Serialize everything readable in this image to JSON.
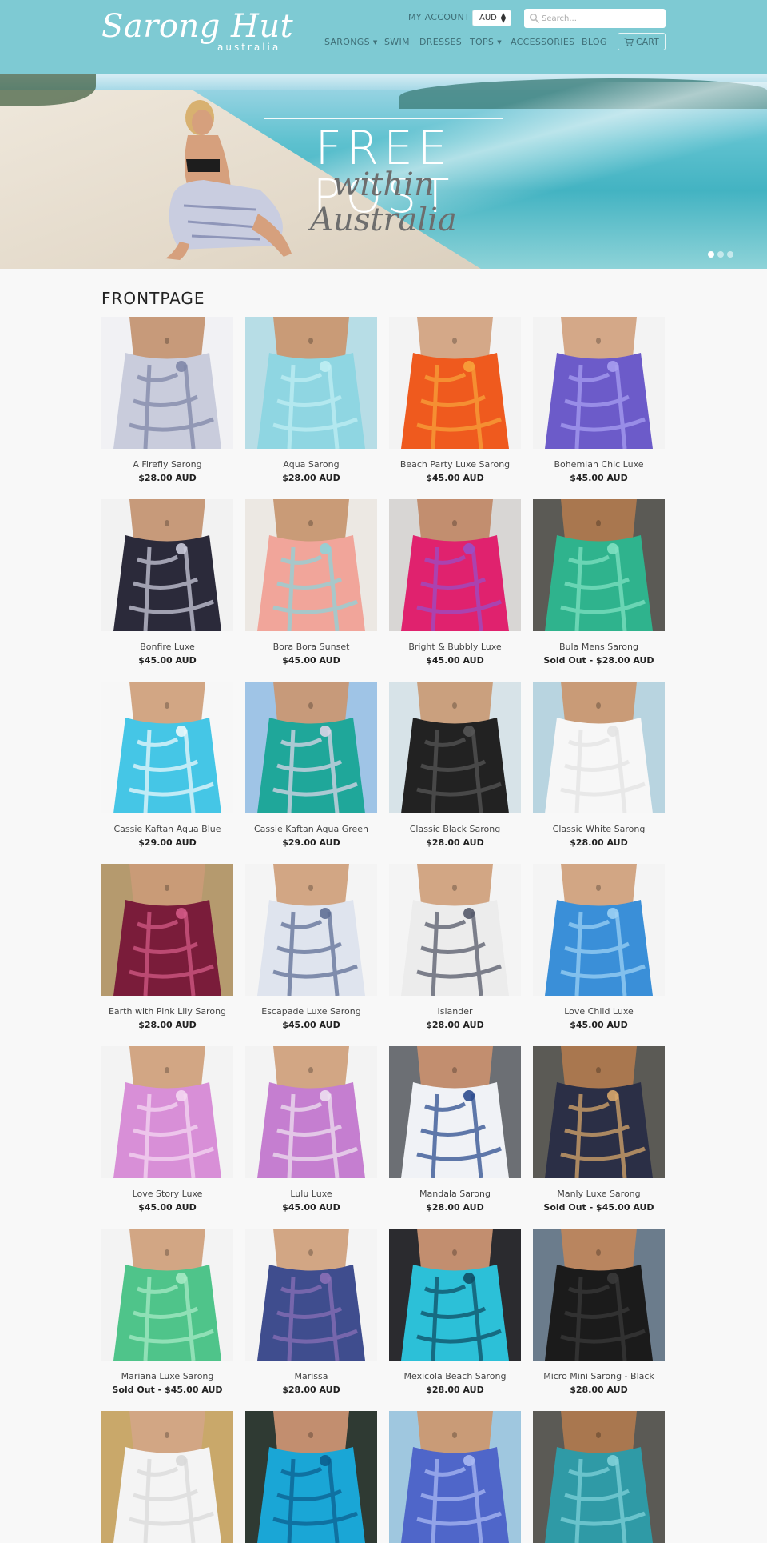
{
  "header": {
    "logo_main": "Sarong Hut",
    "logo_sub": "australia",
    "my_account": "MY ACCOUNT",
    "currency": "AUD",
    "search_placeholder": "Search...",
    "nav": [
      {
        "label": "SARONGS",
        "dropdown": true
      },
      {
        "label": "SWIM",
        "dropdown": false
      },
      {
        "label": "DRESSES",
        "dropdown": false
      },
      {
        "label": "TOPS",
        "dropdown": true
      },
      {
        "label": "ACCESSORIES",
        "dropdown": false
      },
      {
        "label": "BLOG",
        "dropdown": false
      }
    ],
    "cart": "CART"
  },
  "hero": {
    "line1": "FREE POST",
    "line2": "within Australia",
    "slides": 3,
    "active_slide": 1
  },
  "page_title": "FRONTPAGE",
  "products": [
    {
      "name": "A Firefly Sarong",
      "price": "$28.00 AUD",
      "bg": "#f1f1f4",
      "fabric": "#c9ccdc",
      "pattern": "#7f87a8",
      "skin": "#c79a7a"
    },
    {
      "name": "Aqua Sarong",
      "price": "$28.00 AUD",
      "bg": "#b7dde6",
      "fabric": "#8fd6e2",
      "pattern": "#bfeef3",
      "skin": "#c99b77"
    },
    {
      "name": "Beach Party Luxe Sarong",
      "price": "$45.00 AUD",
      "bg": "#f3f3f3",
      "fabric": "#ef5a1e",
      "pattern": "#f7a23a",
      "skin": "#d4a888"
    },
    {
      "name": "Bohemian Chic Luxe",
      "price": "$45.00 AUD",
      "bg": "#f3f3f3",
      "fabric": "#6c5bc9",
      "pattern": "#a79df0",
      "skin": "#d4a888"
    },
    {
      "name": "Bonfire Luxe",
      "price": "$45.00 AUD",
      "bg": "#f2f2f2",
      "fabric": "#2b2a3a",
      "pattern": "#c9c9d9",
      "skin": "#c79a7a"
    },
    {
      "name": "Bora Bora Sunset",
      "price": "$45.00 AUD",
      "bg": "#ece8e3",
      "fabric": "#f1a59a",
      "pattern": "#8fd3d8",
      "skin": "#c99b77"
    },
    {
      "name": "Bright & Bubbly Luxe",
      "price": "$45.00 AUD",
      "bg": "#d8d6d4",
      "fabric": "#e0226e",
      "pattern": "#9a4ec6",
      "skin": "#c28e6f"
    },
    {
      "name": "Bula Mens Sarong",
      "price": "Sold Out - $28.00 AUD",
      "bg": "#5b5a55",
      "fabric": "#2fb38d",
      "pattern": "#7fe0c1",
      "skin": "#a9774f"
    },
    {
      "name": "Cassie Kaftan Aqua Blue",
      "price": "$29.00 AUD",
      "bg": "#f7f7f7",
      "fabric": "#45c6e6",
      "pattern": "#e9f7fb",
      "skin": "#d2a684"
    },
    {
      "name": "Cassie Kaftan Aqua Green",
      "price": "$29.00 AUD",
      "bg": "#9fc4e6",
      "fabric": "#1fa79a",
      "pattern": "#d9d4e6",
      "skin": "#c79a7a"
    },
    {
      "name": "Classic Black Sarong",
      "price": "$28.00 AUD",
      "bg": "#d7e3e8",
      "fabric": "#222222",
      "pattern": "#555555",
      "skin": "#caa07e"
    },
    {
      "name": "Classic White Sarong",
      "price": "$28.00 AUD",
      "bg": "#b8d4e0",
      "fabric": "#f7f7f7",
      "pattern": "#e3e3e3",
      "skin": "#c99b77"
    },
    {
      "name": "Earth with Pink Lily Sarong",
      "price": "$28.00 AUD",
      "bg": "#b59a6e",
      "fabric": "#7a1c3a",
      "pattern": "#d35a86",
      "skin": "#c99b77"
    },
    {
      "name": "Escapade Luxe Sarong",
      "price": "$45.00 AUD",
      "bg": "#f4f4f4",
      "fabric": "#dfe4ee",
      "pattern": "#5f6f95",
      "skin": "#d2a684"
    },
    {
      "name": "Islander",
      "price": "$28.00 AUD",
      "bg": "#f4f4f4",
      "fabric": "#ececec",
      "pattern": "#555a6a",
      "skin": "#d2a684"
    },
    {
      "name": "Love Child Luxe",
      "price": "$45.00 AUD",
      "bg": "#f4f4f4",
      "fabric": "#3a8fd8",
      "pattern": "#9bd0f4",
      "skin": "#d2a684"
    },
    {
      "name": "Love Story Luxe",
      "price": "$45.00 AUD",
      "bg": "#f3f3f3",
      "fabric": "#d88fd7",
      "pattern": "#f4d7f2",
      "skin": "#d2a684"
    },
    {
      "name": "Lulu Luxe",
      "price": "$45.00 AUD",
      "bg": "#f3f3f3",
      "fabric": "#c57ed0",
      "pattern": "#ece0ef",
      "skin": "#d2a684"
    },
    {
      "name": "Mandala Sarong",
      "price": "$28.00 AUD",
      "bg": "#6c6f74",
      "fabric": "#f0f2f6",
      "pattern": "#2d4d8f",
      "skin": "#c28e6f"
    },
    {
      "name": "Manly Luxe Sarong",
      "price": "Sold Out - $45.00 AUD",
      "bg": "#5b5a55",
      "fabric": "#2b2f46",
      "pattern": "#d7a76b",
      "skin": "#a9774f"
    },
    {
      "name": "Mariana Luxe Sarong",
      "price": "Sold Out - $45.00 AUD",
      "bg": "#f3f3f3",
      "fabric": "#4fc48a",
      "pattern": "#a6eac4",
      "skin": "#d2a684"
    },
    {
      "name": "Marissa",
      "price": "$28.00 AUD",
      "bg": "#f4f4f4",
      "fabric": "#3f4d8e",
      "pattern": "#8a6fb6",
      "skin": "#d2a684"
    },
    {
      "name": "Mexicola Beach Sarong",
      "price": "$28.00 AUD",
      "bg": "#2b2b2f",
      "fabric": "#2cc0d8",
      "pattern": "#0f4f66",
      "skin": "#c28e6f"
    },
    {
      "name": "Micro Mini Sarong - Black",
      "price": "$28.00 AUD",
      "bg": "#6b7c8c",
      "fabric": "#1b1b1b",
      "pattern": "#3a3a3a",
      "skin": "#b9855f"
    },
    {
      "name": "",
      "price": "",
      "bg": "#c9a86a",
      "fabric": "#f4f4f4",
      "pattern": "#d9d9d9",
      "skin": "#d2a684"
    },
    {
      "name": "",
      "price": "",
      "bg": "#2f3a33",
      "fabric": "#1aa6d6",
      "pattern": "#0c5f8f",
      "skin": "#c28e6f"
    },
    {
      "name": "",
      "price": "",
      "bg": "#9fc7df",
      "fabric": "#4f66c9",
      "pattern": "#a8b8f2",
      "skin": "#c99b77"
    },
    {
      "name": "",
      "price": "",
      "bg": "#5b5a55",
      "fabric": "#2f9aa6",
      "pattern": "#7fd0d8",
      "skin": "#a9774f"
    }
  ]
}
